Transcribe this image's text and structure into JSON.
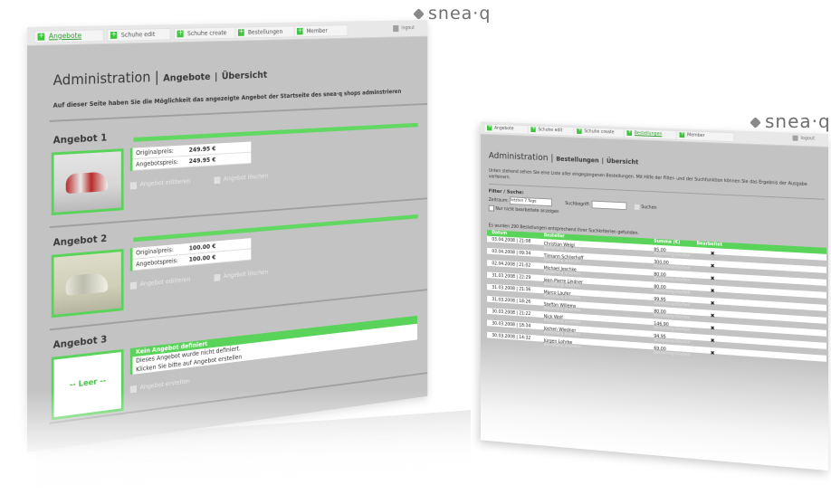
{
  "logo_text": "snea·q",
  "screen1": {
    "nav": [
      "Angebote",
      "Schuhe edit",
      "Schuhe create",
      "Bestellungen",
      "Member"
    ],
    "logout": "logout",
    "title_main": "Administration",
    "title_sep": "|",
    "title_sub1": "Angebote",
    "title_sub2": "Übersicht",
    "intro": "Auf dieser Seite haben Sie die Möglichkeit das angezeigte Angebot der Startseite des snea·q shops adminstrieren",
    "offers": [
      {
        "title": "Angebot 1",
        "price_label": "Originalpreis:",
        "price": "249.95 €",
        "offer_label": "Angebotspreis:",
        "offer_price": "249.95 €",
        "edit": "Angebot editieren",
        "delete": "Angebot löschen"
      },
      {
        "title": "Angebot 2",
        "price_label": "Originalpreis:",
        "price": "100.00 €",
        "offer_label": "Angebotspreis:",
        "offer_price": "100.00 €",
        "edit": "Angebot editieren",
        "delete": "Angebot löschen"
      },
      {
        "title": "Angebot 3",
        "empty_label": "-- Leer --",
        "none_title": "Kein Angebot definiert",
        "none_text1": "Dieses Angebot wurde nicht definiert.",
        "none_text2": "Klicken Sie bitte auf Angebot erstellen",
        "create": "Angebot erstellen"
      }
    ]
  },
  "screen2": {
    "nav": [
      "Angebote",
      "Schuhe edit",
      "Schuhe create",
      "Bestellungen",
      "Member"
    ],
    "logout": "logout",
    "title_main": "Administration",
    "title_sep": "|",
    "title_sub1": "Bestellungen",
    "title_sub2": "Übersicht",
    "intro": "Unten stehend sehen Sie eine Liste aller eingegangenen Bestellungen. Mit Hilfe der Filter- und der Suchfunktion können Sie das Ergebnis der Ausgabe verfeinern.",
    "filter_title": "Filter / Suche:",
    "filter_label": "Zeitraum:",
    "filter_value": "letzten 7 Tage",
    "search_label": "Suchbegriff:",
    "search_button": "Suchen",
    "checkbox_label": "Nur nicht bearbeitete anzeigen",
    "found_text": "Es wurden 290 Bestellungen entsprechend Ihrer Suchkriterien gefunden.",
    "headers": [
      "Datum",
      "Besteller",
      "Summe (€)",
      "Bearbeitet"
    ],
    "link_detail": "Bestellung ansehen",
    "link_delete": "Bestellung löschen",
    "rows": [
      {
        "date": "03.04.2008 | 21:08",
        "name": "Christian Weigl",
        "sum": "85,00"
      },
      {
        "date": "03.04.2008 | 09:34",
        "name": "Tilmann Schlierhoff",
        "sum": "300,00"
      },
      {
        "date": "02.04.2008 | 21:02",
        "name": "Michael Jeschke",
        "sum": "80,00"
      },
      {
        "date": "31.03.2008 | 22:29",
        "name": "Jean-Pierre Lindner",
        "sum": "80,00"
      },
      {
        "date": "31.03.2008 | 21:36",
        "name": "Marco Laufer",
        "sum": "99,95"
      },
      {
        "date": "31.03.2008 | 18:26",
        "name": "Steffan Willems",
        "sum": "80,00"
      },
      {
        "date": "30.03.2008 | 21:22",
        "name": "Nick Wolf",
        "sum": "146,90"
      },
      {
        "date": "30.03.2008 | 18:34",
        "name": "Jochen Wiedner",
        "sum": "94,95"
      },
      {
        "date": "30.03.2008 | 14:32",
        "name": "Jürgen Lohrke",
        "sum": "69,00"
      }
    ]
  }
}
